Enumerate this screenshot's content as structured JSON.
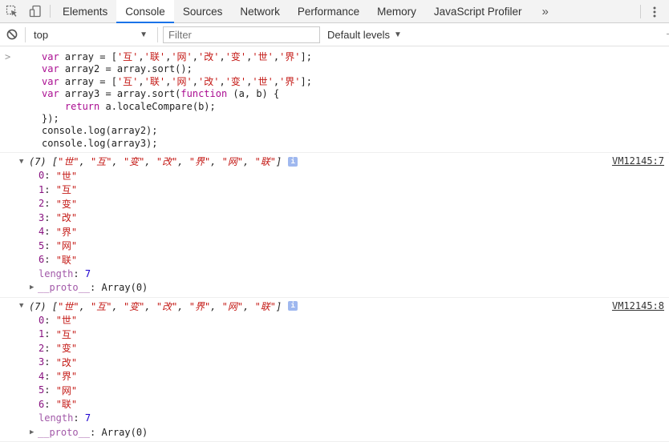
{
  "tabs": {
    "items": [
      {
        "label": "Elements",
        "active": false
      },
      {
        "label": "Console",
        "active": true
      },
      {
        "label": "Sources",
        "active": false
      },
      {
        "label": "Network",
        "active": false
      },
      {
        "label": "Performance",
        "active": false
      },
      {
        "label": "Memory",
        "active": false
      },
      {
        "label": "JavaScript Profiler",
        "active": false
      }
    ],
    "more": "»"
  },
  "toolbar": {
    "context": "top",
    "filter_placeholder": "Filter",
    "levels": "Default levels"
  },
  "command": {
    "prompt": ">",
    "lines": [
      "    var array = ['互','联','网','改','变','世','界'];",
      "    var array2 = array.sort();",
      "    var array = ['互','联','网','改','变','世','界'];",
      "    var array3 = array.sort(function (a, b) {",
      "        return a.localeCompare(b);",
      "    });",
      "    console.log(array2);",
      "    console.log(array3);"
    ]
  },
  "logs": [
    {
      "summary": "(7) [\"世\", \"互\", \"变\", \"改\", \"界\", \"网\", \"联\"]",
      "source": "VM12145:7",
      "items": [
        {
          "key": "0",
          "value": "\"世\""
        },
        {
          "key": "1",
          "value": "\"互\""
        },
        {
          "key": "2",
          "value": "\"变\""
        },
        {
          "key": "3",
          "value": "\"改\""
        },
        {
          "key": "4",
          "value": "\"界\""
        },
        {
          "key": "5",
          "value": "\"网\""
        },
        {
          "key": "6",
          "value": "\"联\""
        }
      ],
      "length_key": "length",
      "length_value": "7",
      "proto_key": "__proto__",
      "proto_value": "Array(0)"
    },
    {
      "summary": "(7) [\"世\", \"互\", \"变\", \"改\", \"界\", \"网\", \"联\"]",
      "source": "VM12145:8",
      "items": [
        {
          "key": "0",
          "value": "\"世\""
        },
        {
          "key": "1",
          "value": "\"互\""
        },
        {
          "key": "2",
          "value": "\"变\""
        },
        {
          "key": "3",
          "value": "\"改\""
        },
        {
          "key": "4",
          "value": "\"界\""
        },
        {
          "key": "5",
          "value": "\"网\""
        },
        {
          "key": "6",
          "value": "\"联\""
        }
      ],
      "length_key": "length",
      "length_value": "7",
      "proto_key": "__proto__",
      "proto_value": "Array(0)"
    }
  ],
  "colors": {
    "active_tab_accent": "#1a73e8",
    "keyword": "#aa0d91",
    "string": "#c41a16",
    "number": "#1c00cf",
    "property_key": "#881280"
  },
  "icons": {
    "inspect": "inspect-element-icon",
    "device": "device-toolbar-icon",
    "clear": "clear-console-icon",
    "menu": "kebab-menu-icon",
    "info": "info-icon"
  }
}
